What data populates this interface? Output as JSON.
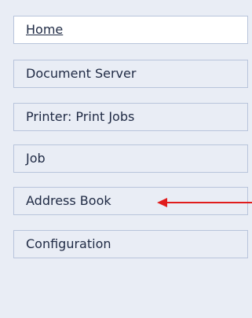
{
  "sidebar": {
    "items": [
      {
        "label": "Home",
        "active": true
      },
      {
        "label": "Document Server",
        "active": false
      },
      {
        "label": "Printer: Print Jobs",
        "active": false
      },
      {
        "label": "Job",
        "active": false
      },
      {
        "label": "Address Book",
        "active": false
      },
      {
        "label": "Configuration",
        "active": false
      }
    ]
  },
  "annotation": {
    "arrow_color": "#e01c1c"
  },
  "colors": {
    "panel_bg": "#e9edf5",
    "item_border": "#b8c4db",
    "active_bg": "#ffffff",
    "text": "#1f2a44"
  }
}
